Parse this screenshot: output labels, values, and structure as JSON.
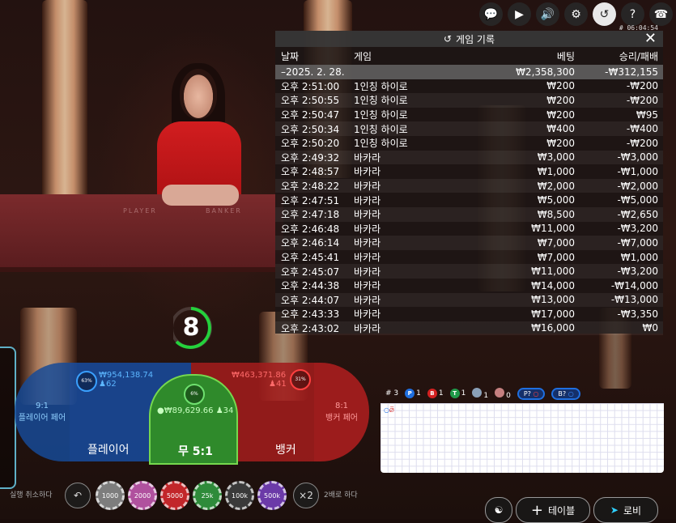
{
  "topbar": {
    "icons": [
      "chat-icon",
      "video-icon",
      "sound-icon",
      "gear-icon",
      "history-icon",
      "help-icon",
      "support-icon"
    ],
    "clock": "# 06:04:54"
  },
  "table_felt": {
    "left_text": "PLAYER",
    "right_text": "BANKER"
  },
  "history": {
    "title": "게임 기록",
    "columns": {
      "date": "날짜",
      "game": "게임",
      "bet": "베팅",
      "win": "승리/패배"
    },
    "summary": {
      "date": "–2025. 2. 28.",
      "game": "",
      "bet": "₩2,358,300",
      "win": "-₩312,155"
    },
    "rows": [
      {
        "time": "오후 2:51:00",
        "game": "1인칭 하이로",
        "bet": "₩200",
        "win": "-₩200"
      },
      {
        "time": "오후 2:50:55",
        "game": "1인칭 하이로",
        "bet": "₩200",
        "win": "-₩200"
      },
      {
        "time": "오후 2:50:47",
        "game": "1인칭 하이로",
        "bet": "₩200",
        "win": "₩95"
      },
      {
        "time": "오후 2:50:34",
        "game": "1인칭 하이로",
        "bet": "₩400",
        "win": "-₩400"
      },
      {
        "time": "오후 2:50:20",
        "game": "1인칭 하이로",
        "bet": "₩200",
        "win": "-₩200"
      },
      {
        "time": "오후 2:49:32",
        "game": "바카라",
        "bet": "₩3,000",
        "win": "-₩3,000"
      },
      {
        "time": "오후 2:48:57",
        "game": "바카라",
        "bet": "₩1,000",
        "win": "-₩1,000"
      },
      {
        "time": "오후 2:48:22",
        "game": "바카라",
        "bet": "₩2,000",
        "win": "-₩2,000"
      },
      {
        "time": "오후 2:47:51",
        "game": "바카라",
        "bet": "₩5,000",
        "win": "-₩5,000"
      },
      {
        "time": "오후 2:47:18",
        "game": "바카라",
        "bet": "₩8,500",
        "win": "-₩2,650"
      },
      {
        "time": "오후 2:46:48",
        "game": "바카라",
        "bet": "₩11,000",
        "win": "-₩3,200"
      },
      {
        "time": "오후 2:46:14",
        "game": "바카라",
        "bet": "₩7,000",
        "win": "-₩7,000"
      },
      {
        "time": "오후 2:45:41",
        "game": "바카라",
        "bet": "₩7,000",
        "win": "₩1,000"
      },
      {
        "time": "오후 2:45:07",
        "game": "바카라",
        "bet": "₩11,000",
        "win": "-₩3,200"
      },
      {
        "time": "오후 2:44:38",
        "game": "바카라",
        "bet": "₩14,000",
        "win": "-₩14,000"
      },
      {
        "time": "오후 2:44:07",
        "game": "바카라",
        "bet": "₩13,000",
        "win": "-₩13,000"
      },
      {
        "time": "오후 2:43:33",
        "game": "바카라",
        "bet": "₩17,000",
        "win": "-₩3,350"
      },
      {
        "time": "오후 2:43:02",
        "game": "바카라",
        "bet": "₩16,000",
        "win": "₩0"
      }
    ]
  },
  "timer": {
    "value": "8"
  },
  "bets": {
    "player_pair": {
      "odds": "9:1",
      "label": "플레이어 페어"
    },
    "player": {
      "label": "플레이어",
      "pct": "63%",
      "amount": "₩954,138.74",
      "players": "62"
    },
    "tie": {
      "label": "무 5:1",
      "pct": "6%",
      "amount": "₩89,629.66",
      "players": "34"
    },
    "banker": {
      "label": "뱅커",
      "pct": "31%",
      "amount": "₩463,371.86",
      "players": "41"
    },
    "banker_pair": {
      "odds": "8:1",
      "label": "뱅커 페어"
    }
  },
  "road": {
    "count_label": "# 3",
    "p": "1",
    "b": "1",
    "t": "1",
    "pp": "1",
    "bp": "0",
    "p_ask": "P?",
    "b_ask": "B?",
    "colors": {
      "player": "#1f6fe0",
      "banker": "#d42121",
      "tie": "#1f9a4a"
    }
  },
  "controls": {
    "undo_label": "실행 취소하다",
    "double_label": "2배로 하다",
    "double_symbol": "×2",
    "chips": [
      {
        "value": "1000",
        "color": "#7d7d7d"
      },
      {
        "value": "2000",
        "color": "#b0519e"
      },
      {
        "value": "5000",
        "color": "#c2262a"
      },
      {
        "value": "25k",
        "color": "#2e8b3a"
      },
      {
        "value": "100k",
        "color": "#3a3a3a"
      },
      {
        "value": "500k",
        "color": "#6b3aa8"
      }
    ]
  },
  "bottom_buttons": {
    "table": "테이블",
    "lobby": "로비"
  }
}
